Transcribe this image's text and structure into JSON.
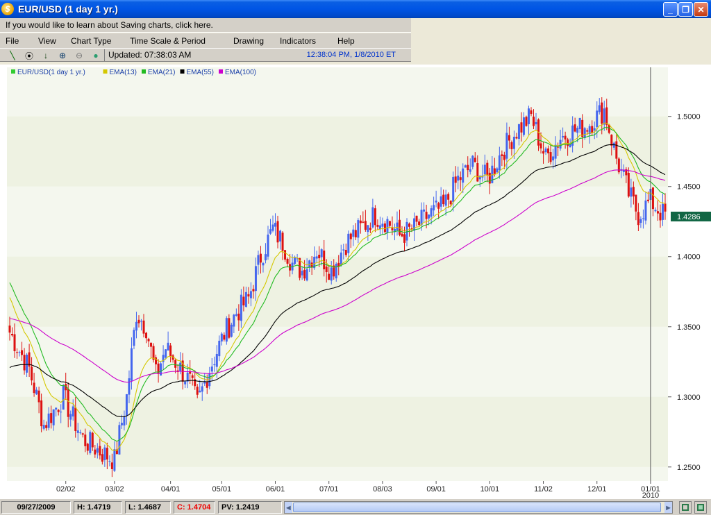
{
  "window": {
    "title": "EUR/USD (1 day  1 yr.)",
    "min_icon": "minimize-icon",
    "max_icon": "restore-icon",
    "close_icon": "close-icon"
  },
  "infobar": {
    "text": "If you would like to learn about Saving charts, click here."
  },
  "menu": [
    "File",
    "View",
    "Chart Type",
    "Time Scale & Period",
    "Drawing",
    "Indicators",
    "Help"
  ],
  "toolbar": {
    "icons": [
      "draw-line-icon",
      "crosshair-icon",
      "down-arrow-icon",
      "zoom-in-icon",
      "zoom-out-icon",
      "refresh-icon"
    ],
    "updated": "Updated: 07:38:03 AM",
    "clock": "12:38:04 PM, 1/8/2010 ET"
  },
  "legend": [
    {
      "label": "EUR/USD(1 day  1 yr.)",
      "color": "#33cc33"
    },
    {
      "label": "EMA(13)",
      "color": "#d4c800"
    },
    {
      "label": "EMA(21)",
      "color": "#22bb22"
    },
    {
      "label": "EMA(55)",
      "color": "#000000"
    },
    {
      "label": "EMA(100)",
      "color": "#cc00cc"
    }
  ],
  "status": {
    "date": "09/27/2009",
    "high": "H: 1.4719",
    "low": "L: 1.4687",
    "close": "C: 1.4704",
    "pv": "PV: 1.2419"
  },
  "chart_data": {
    "type": "candlestick",
    "title": "",
    "ylim": [
      1.24,
      1.535
    ],
    "y_ticks": [
      "1.5000",
      "1.4500",
      "1.4000",
      "1.3500",
      "1.3000",
      "1.2500"
    ],
    "y_tick_values": [
      1.5,
      1.45,
      1.4,
      1.35,
      1.3,
      1.25
    ],
    "x_ticks": [
      "02/02",
      "03/02",
      "04/01",
      "05/01",
      "06/01",
      "07/01",
      "08/03",
      "09/01",
      "10/01",
      "11/02",
      "12/01",
      "01/01"
    ],
    "x_tick_index": [
      23,
      43,
      66,
      87,
      109,
      131,
      153,
      175,
      197,
      219,
      241,
      263
    ],
    "x_year_label": "2010",
    "last_price": "1.4286",
    "last_price_value": 1.4286,
    "up_color": "#4466ee",
    "down_color": "#dd1111",
    "closes_anchor": [
      [
        0,
        1.346
      ],
      [
        8,
        1.32
      ],
      [
        14,
        1.28
      ],
      [
        22,
        1.3
      ],
      [
        30,
        1.27
      ],
      [
        38,
        1.26
      ],
      [
        43,
        1.255
      ],
      [
        48,
        1.3
      ],
      [
        52,
        1.36
      ],
      [
        56,
        1.35
      ],
      [
        60,
        1.315
      ],
      [
        64,
        1.335
      ],
      [
        70,
        1.32
      ],
      [
        74,
        1.31
      ],
      [
        77,
        1.295
      ],
      [
        82,
        1.32
      ],
      [
        88,
        1.345
      ],
      [
        93,
        1.36
      ],
      [
        98,
        1.37
      ],
      [
        103,
        1.4
      ],
      [
        108,
        1.42
      ],
      [
        112,
        1.41
      ],
      [
        116,
        1.395
      ],
      [
        120,
        1.39
      ],
      [
        126,
        1.405
      ],
      [
        132,
        1.39
      ],
      [
        138,
        1.41
      ],
      [
        144,
        1.42
      ],
      [
        150,
        1.43
      ],
      [
        155,
        1.425
      ],
      [
        160,
        1.415
      ],
      [
        166,
        1.42
      ],
      [
        172,
        1.43
      ],
      [
        178,
        1.435
      ],
      [
        184,
        1.455
      ],
      [
        190,
        1.465
      ],
      [
        196,
        1.455
      ],
      [
        202,
        1.475
      ],
      [
        208,
        1.49
      ],
      [
        214,
        1.5
      ],
      [
        220,
        1.47
      ],
      [
        226,
        1.485
      ],
      [
        232,
        1.49
      ],
      [
        238,
        1.495
      ],
      [
        244,
        1.505
      ],
      [
        249,
        1.47
      ],
      [
        254,
        1.445
      ],
      [
        258,
        1.43
      ],
      [
        263,
        1.44
      ],
      [
        268,
        1.43
      ]
    ],
    "series": [
      {
        "name": "EMA(13)",
        "period": 13,
        "color": "#d4c800"
      },
      {
        "name": "EMA(21)",
        "period": 21,
        "color": "#22bb22"
      },
      {
        "name": "EMA(55)",
        "period": 55,
        "color": "#000000"
      },
      {
        "name": "EMA(100)",
        "period": 100,
        "color": "#cc00cc"
      }
    ],
    "ema_seed": {
      "EMA(13)": 1.375,
      "EMA(21)": 1.385,
      "EMA(55)": 1.32,
      "EMA(100)": 1.356
    },
    "candle_count": 270,
    "grid": true
  }
}
